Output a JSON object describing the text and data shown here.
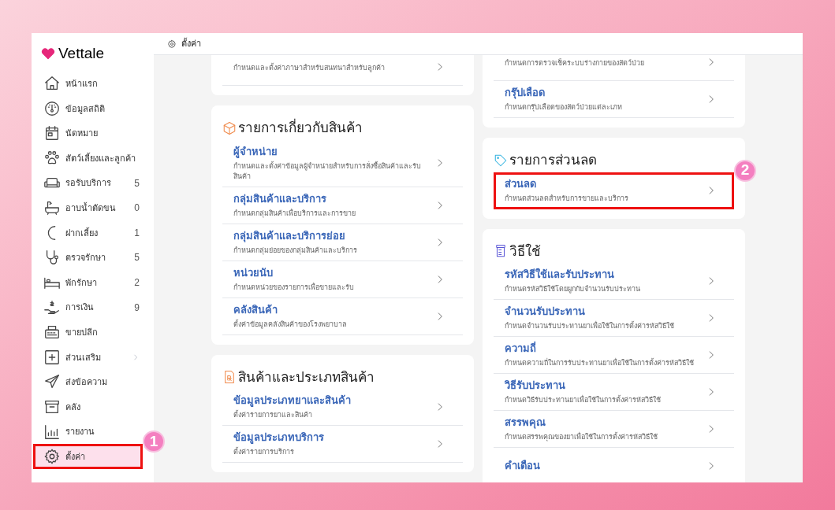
{
  "sidebar": {
    "logo": "Vettale",
    "items": [
      {
        "label": "หน้าแรก",
        "selected": false
      },
      {
        "label": "ข้อมูลสถิติ",
        "selected": false
      },
      {
        "label": "นัดหมาย",
        "selected": false
      },
      {
        "label": "สัตว์เลี้ยงและลูกค้า",
        "selected": false
      },
      {
        "label": "รอรับบริการ",
        "count": "5",
        "selected": false
      },
      {
        "label": "อาบน้ำตัดขน",
        "count": "0",
        "selected": false
      },
      {
        "label": "ฝากเลี้ยง",
        "count": "1",
        "selected": false
      },
      {
        "label": "ตรวจรักษา",
        "count": "5",
        "selected": false
      },
      {
        "label": "พักรักษา",
        "count": "2",
        "selected": false
      },
      {
        "label": "การเงิน",
        "count": "9",
        "selected": false
      },
      {
        "label": "ขายปลีก",
        "selected": false
      },
      {
        "label": "ส่วนเสริม",
        "has_submenu": true,
        "selected": false
      },
      {
        "label": "ส่งข้อความ",
        "selected": false
      },
      {
        "label": "คลัง",
        "selected": false
      },
      {
        "label": "รายงาน",
        "selected": false
      },
      {
        "label": "ตั้งค่า",
        "selected": true,
        "callout": "1"
      }
    ]
  },
  "topbar": {
    "title": "ตั้งค่า"
  },
  "columns": [
    [
      {
        "kind": "cut",
        "items": [
          {
            "description": "กำหนดและตั้งค่าภาษาสำหรับสนทนาสำหรับลูกค้า"
          }
        ]
      },
      {
        "kind": "box",
        "title": "รายการเกี่ยวกับสินค้า",
        "items": [
          {
            "title": "ผู้จำหน่าย",
            "description": "กำหนดและตั้งค่าข้อมูลผู้จำหน่ายสำหรับการสั่งซื้อสินค้าและรับสินค้า"
          },
          {
            "title": "กลุ่มสินค้าและบริการ",
            "description": "กำหนดกลุ่มสินค้าเพื่อบริการและการขาย"
          },
          {
            "title": "กลุ่มสินค้าและบริการย่อย",
            "description": "กำหนดกลุ่มย่อยของกลุ่มสินค้าและบริการ"
          },
          {
            "title": "หน่วยนับ",
            "description": "กำหนดหน่วยของรายการเพื่อขายและรับ"
          },
          {
            "title": "คลังสินค้า",
            "description": "ตั้งค่าข้อมูลคลังสินค้าของโรงพยาบาล"
          }
        ]
      },
      {
        "kind": "rx",
        "title": "สินค้าและประเภทสินค้า",
        "items": [
          {
            "title": "ข้อมูลประเภทยาและสินค้า",
            "description": "ตั้งค่ารายการยาและสินค้า"
          },
          {
            "title": "ข้อมูลประเภทบริการ",
            "description": "ตั้งค่ารายการบริการ"
          }
        ]
      }
    ],
    [
      {
        "kind": "cut",
        "items": [
          {
            "description": "กำหนดการตรวจเช็คระบบร่างกายของสัตว์ป่วย"
          },
          {
            "title": "กรุ๊ปเลือด",
            "description": "กำหนดกรุ๊ปเลือดของสัตว์ป่วยแต่ละเภท"
          }
        ]
      },
      {
        "kind": "tag",
        "title": "รายการส่วนลด",
        "items": [
          {
            "title": "ส่วนลด",
            "description": "กำหนดส่วนลดสำหรับการขายและบริการ",
            "callout": "2"
          }
        ]
      },
      {
        "kind": "jar",
        "title": "วิธีใช้",
        "items": [
          {
            "title": "รหัสวิธีใช้และรับประทาน",
            "description": "กำหนดรหัสวิธีใช้โดยผูกกับจำนวนรับประทาน"
          },
          {
            "title": "จำนวนรับประทาน",
            "description": "กำหนดจำนวนรับประทานยาเพื่อใช้ในการตั้งค่ารหัสวิธีใช้"
          },
          {
            "title": "ความถี่",
            "description": "กำหนดความถี่ในการรับประทานยาเพื่อใช้ในการตั้งค่ารหัสวิธีใช้"
          },
          {
            "title": "วิธีรับประทาน",
            "description": "กำหนดวิธีรับประทานยาเพื่อใช้ในการตั้งค่ารหัสวิธีใช้"
          },
          {
            "title": "สรรพคุณ",
            "description": "กำหนดสรรพคุณของยาเพื่อใช้ในการตั้งค่ารหัสวิธีใช้"
          },
          {
            "title": "คำเตือน"
          }
        ]
      }
    ]
  ]
}
